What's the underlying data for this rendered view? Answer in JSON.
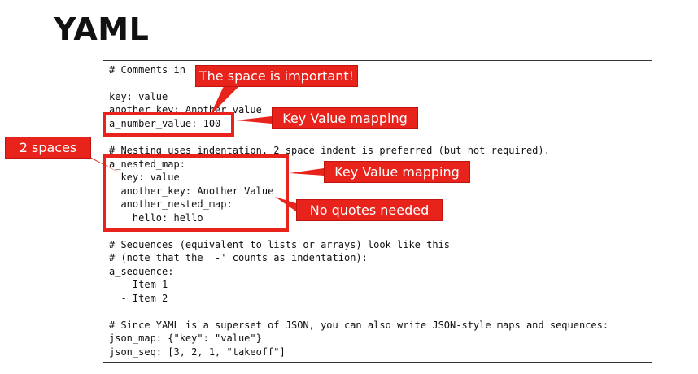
{
  "slide": {
    "title": "YAML"
  },
  "code_lines": [
    "# Comments in",
    "",
    "key: value",
    "another_key: Another value",
    "a_number_value: 100",
    "",
    "# Nesting uses indentation. 2 space indent is preferred (but not required).",
    "a_nested_map:",
    "  key: value",
    "  another_key: Another Value",
    "  another_nested_map:",
    "    hello: hello",
    "",
    "# Sequences (equivalent to lists or arrays) look like this",
    "# (note that the '-' counts as indentation):",
    "a_sequence:",
    "  - Item 1",
    "  - Item 2",
    "",
    "# Since YAML is a superset of JSON, you can also write JSON-style maps and sequences:",
    "json_map: {\"key\": \"value\"}",
    "json_seq: [3, 2, 1, \"takeoff\"]"
  ],
  "callouts": {
    "space_important": "The space is important!",
    "key_value_1": "Key Value mapping",
    "two_spaces": "2 spaces",
    "key_value_2": "Key Value mapping",
    "no_quotes": "No quotes needed"
  },
  "colors": {
    "annotation_red": "#e8231c"
  }
}
